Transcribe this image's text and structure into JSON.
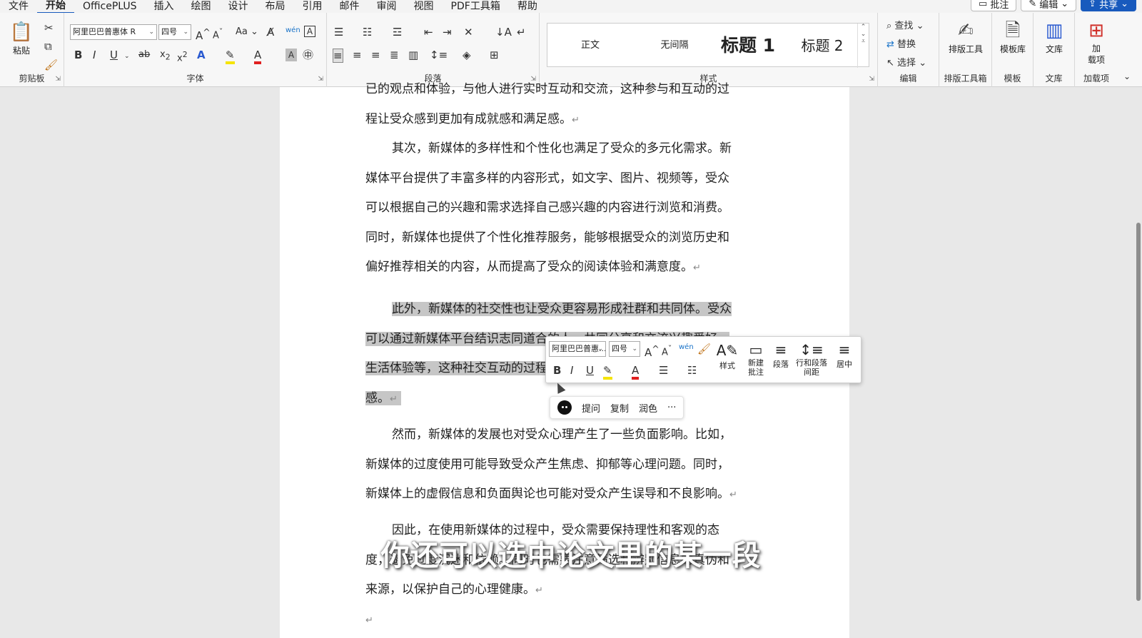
{
  "menubar": {
    "items": [
      "文件",
      "开始",
      "OfficePLUS",
      "插入",
      "绘图",
      "设计",
      "布局",
      "引用",
      "邮件",
      "审阅",
      "视图",
      "PDF工具箱",
      "帮助"
    ],
    "comment_label": "批注",
    "edit_label": "编辑",
    "share_label": "共享"
  },
  "ribbon": {
    "clipboard": {
      "label": "剪贴板",
      "paste": "粘贴"
    },
    "font": {
      "label": "字体",
      "font_name": "阿里巴巴普惠体 R",
      "font_size": "四号",
      "case": "Aa",
      "wen": "wén"
    },
    "paragraph": {
      "label": "段落"
    },
    "styles": {
      "label": "样式",
      "items": [
        "正文",
        "无间隔",
        "标题 1",
        "标题 2"
      ]
    },
    "editing": {
      "label": "编辑",
      "find": "查找",
      "replace": "替换",
      "select": "选择"
    },
    "layout_tools": {
      "label": "排版工具箱",
      "button": "排版工具"
    },
    "template": {
      "label": "模板",
      "button": "模板库"
    },
    "library": {
      "label": "文库",
      "button": "文库"
    },
    "addins": {
      "label": "加载项",
      "button": "加\n载项"
    }
  },
  "document": {
    "p1": [
      "已的观点和体验，与他人进行实时互动和交流，这种参与和互动的过",
      "程让受众感到更加有成就感和满足感。"
    ],
    "p2": [
      "其次，新媒体的多样性和个性化也满足了受众的多元化需求。新",
      "媒体平台提供了丰富多样的内容形式，如文字、图片、视频等，受众",
      "可以根据自己的兴趣和需求选择自己感兴趣的内容进行浏览和消费。",
      "同时，新媒体也提供了个性化推荐服务，能够根据受众的浏览历史和",
      "偏好推荐相关的内容，从而提高了受众的阅读体验和满意度。"
    ],
    "p3": [
      "此外，新媒体的社交性也让受众更容易形成社群和共同体。受众",
      "可以通过新媒体平台结识志同道合的人，共同分享和交流兴趣爱好、",
      "生活体验等，这种社交互动的过程让受众感受到了归属感和认同",
      "感。"
    ],
    "p4": [
      "然而，新媒体的发展也对受众心理产生了一些负面影响。比如，",
      "新媒体的过度使用可能导致受众产生焦虑、抑郁等心理问题。同时，",
      "新媒体上的虚假信息和负面舆论也可能对受众产生误导和不良影响。"
    ],
    "p5": [
      "因此，在使用新媒体的过程中，受众需要保持理性和客观的态",
      "度，避免过度沉迷和依赖。同时也需要注意筛选和辨别信息的真伪和",
      "来源，以保护自己的心理健康。"
    ]
  },
  "mini_toolbar": {
    "font_name": "阿里巴巴普惠...",
    "font_size": "四号",
    "style_label": "样式",
    "new_comment": "新建\n批注",
    "paragraph": "段落",
    "spacing": "行和段落\n间距",
    "center": "居中"
  },
  "ai_bar": {
    "ask": "提问",
    "copy": "复制",
    "polish": "润色",
    "more": "···"
  },
  "subtitle": "你还可以选中论文里的某一段"
}
